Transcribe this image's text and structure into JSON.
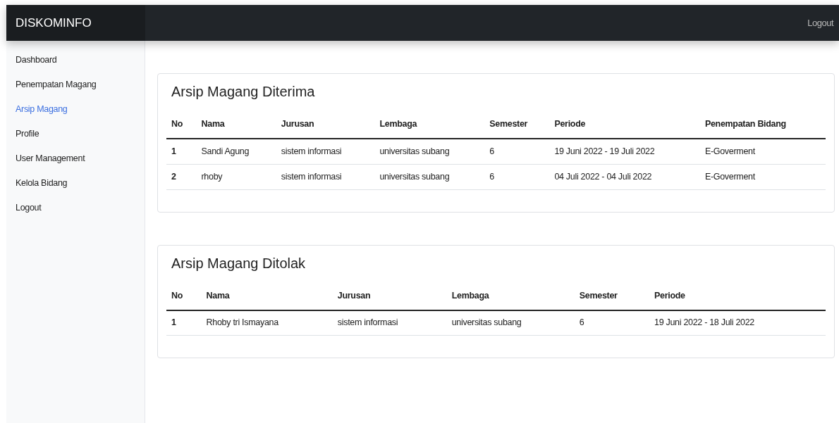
{
  "navbar": {
    "brand": "DISKOMINFO",
    "logout": "Logout"
  },
  "sidebar": {
    "items": [
      {
        "label": "Dashboard",
        "selected": false
      },
      {
        "label": "Penempatan Magang",
        "selected": false
      },
      {
        "label": "Arsip Magang",
        "selected": true
      },
      {
        "label": "Profile",
        "selected": false
      },
      {
        "label": "User Management",
        "selected": false
      },
      {
        "label": "Kelola Bidang",
        "selected": false
      },
      {
        "label": "Logout",
        "selected": false
      }
    ]
  },
  "cards": [
    {
      "title": "Arsip Magang Diterima",
      "columns": [
        "No",
        "Nama",
        "Jurusan",
        "Lembaga",
        "Semester",
        "Periode",
        "Penempatan Bidang"
      ],
      "rows": [
        [
          "1",
          "Sandi Agung",
          "sistem informasi",
          "universitas subang",
          "6",
          "19 Juni 2022 - 19 Juli 2022",
          "E-Goverment"
        ],
        [
          "2",
          "rhoby",
          "sistem informasi",
          "universitas subang",
          "6",
          "04 Juli 2022 - 04 Juli 2022",
          "E-Goverment"
        ]
      ]
    },
    {
      "title": "Arsip Magang Ditolak",
      "columns": [
        "No",
        "Nama",
        "Jurusan",
        "Lembaga",
        "Semester",
        "Periode"
      ],
      "rows": [
        [
          "1",
          "Rhoby tri Ismayana",
          "sistem informasi",
          "universitas subang",
          "6",
          "19 Juni 2022 - 18 Juli 2022"
        ]
      ]
    }
  ]
}
